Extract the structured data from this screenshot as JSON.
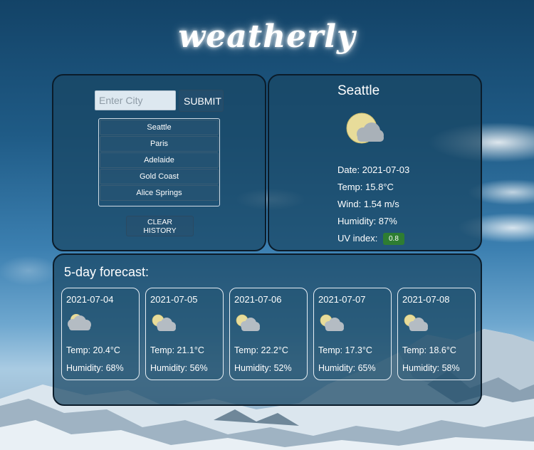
{
  "app": {
    "title": "weatherly"
  },
  "search": {
    "placeholder": "Enter City",
    "value": "",
    "submit_label": "SUBMIT",
    "clear_label": "CLEAR HISTORY",
    "history": [
      "Seattle",
      "Paris",
      "Adelaide",
      "Gold Coast",
      "Alice Springs"
    ]
  },
  "current": {
    "city": "Seattle",
    "icon": "partly-cloudy-icon",
    "date": "Date: 2021-07-03",
    "temp": "Temp: 15.8°C",
    "wind": "Wind: 1.54 m/s",
    "humidity": "Humidity: 87%",
    "uv_label": "UV index:",
    "uv_value": "0.8",
    "uv_color": "#2e7d32"
  },
  "forecast": {
    "title": "5-day forecast:",
    "days": [
      {
        "date": "2021-07-04",
        "icon": "cloudy-icon",
        "temp": "Temp: 20.4°C",
        "humidity": "Humidity: 68%"
      },
      {
        "date": "2021-07-05",
        "icon": "partly-cloudy-icon",
        "temp": "Temp: 21.1°C",
        "humidity": "Humidity: 56%"
      },
      {
        "date": "2021-07-06",
        "icon": "partly-cloudy-icon",
        "temp": "Temp: 22.2°C",
        "humidity": "Humidity: 52%"
      },
      {
        "date": "2021-07-07",
        "icon": "partly-cloudy-icon",
        "temp": "Temp: 17.3°C",
        "humidity": "Humidity: 65%"
      },
      {
        "date": "2021-07-08",
        "icon": "partly-cloudy-icon",
        "temp": "Temp: 18.6°C",
        "humidity": "Humidity: 58%"
      }
    ]
  }
}
